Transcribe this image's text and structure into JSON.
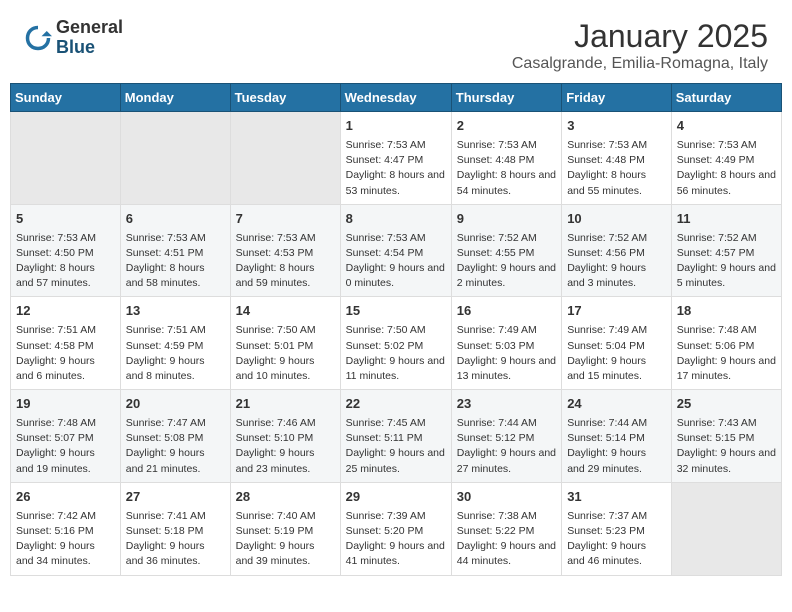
{
  "header": {
    "logo_general": "General",
    "logo_blue": "Blue",
    "month_title": "January 2025",
    "subtitle": "Casalgrande, Emilia-Romagna, Italy"
  },
  "weekdays": [
    "Sunday",
    "Monday",
    "Tuesday",
    "Wednesday",
    "Thursday",
    "Friday",
    "Saturday"
  ],
  "weeks": [
    [
      {
        "day": "",
        "info": ""
      },
      {
        "day": "",
        "info": ""
      },
      {
        "day": "",
        "info": ""
      },
      {
        "day": "1",
        "info": "Sunrise: 7:53 AM\nSunset: 4:47 PM\nDaylight: 8 hours and 53 minutes."
      },
      {
        "day": "2",
        "info": "Sunrise: 7:53 AM\nSunset: 4:48 PM\nDaylight: 8 hours and 54 minutes."
      },
      {
        "day": "3",
        "info": "Sunrise: 7:53 AM\nSunset: 4:48 PM\nDaylight: 8 hours and 55 minutes."
      },
      {
        "day": "4",
        "info": "Sunrise: 7:53 AM\nSunset: 4:49 PM\nDaylight: 8 hours and 56 minutes."
      }
    ],
    [
      {
        "day": "5",
        "info": "Sunrise: 7:53 AM\nSunset: 4:50 PM\nDaylight: 8 hours and 57 minutes."
      },
      {
        "day": "6",
        "info": "Sunrise: 7:53 AM\nSunset: 4:51 PM\nDaylight: 8 hours and 58 minutes."
      },
      {
        "day": "7",
        "info": "Sunrise: 7:53 AM\nSunset: 4:53 PM\nDaylight: 8 hours and 59 minutes."
      },
      {
        "day": "8",
        "info": "Sunrise: 7:53 AM\nSunset: 4:54 PM\nDaylight: 9 hours and 0 minutes."
      },
      {
        "day": "9",
        "info": "Sunrise: 7:52 AM\nSunset: 4:55 PM\nDaylight: 9 hours and 2 minutes."
      },
      {
        "day": "10",
        "info": "Sunrise: 7:52 AM\nSunset: 4:56 PM\nDaylight: 9 hours and 3 minutes."
      },
      {
        "day": "11",
        "info": "Sunrise: 7:52 AM\nSunset: 4:57 PM\nDaylight: 9 hours and 5 minutes."
      }
    ],
    [
      {
        "day": "12",
        "info": "Sunrise: 7:51 AM\nSunset: 4:58 PM\nDaylight: 9 hours and 6 minutes."
      },
      {
        "day": "13",
        "info": "Sunrise: 7:51 AM\nSunset: 4:59 PM\nDaylight: 9 hours and 8 minutes."
      },
      {
        "day": "14",
        "info": "Sunrise: 7:50 AM\nSunset: 5:01 PM\nDaylight: 9 hours and 10 minutes."
      },
      {
        "day": "15",
        "info": "Sunrise: 7:50 AM\nSunset: 5:02 PM\nDaylight: 9 hours and 11 minutes."
      },
      {
        "day": "16",
        "info": "Sunrise: 7:49 AM\nSunset: 5:03 PM\nDaylight: 9 hours and 13 minutes."
      },
      {
        "day": "17",
        "info": "Sunrise: 7:49 AM\nSunset: 5:04 PM\nDaylight: 9 hours and 15 minutes."
      },
      {
        "day": "18",
        "info": "Sunrise: 7:48 AM\nSunset: 5:06 PM\nDaylight: 9 hours and 17 minutes."
      }
    ],
    [
      {
        "day": "19",
        "info": "Sunrise: 7:48 AM\nSunset: 5:07 PM\nDaylight: 9 hours and 19 minutes."
      },
      {
        "day": "20",
        "info": "Sunrise: 7:47 AM\nSunset: 5:08 PM\nDaylight: 9 hours and 21 minutes."
      },
      {
        "day": "21",
        "info": "Sunrise: 7:46 AM\nSunset: 5:10 PM\nDaylight: 9 hours and 23 minutes."
      },
      {
        "day": "22",
        "info": "Sunrise: 7:45 AM\nSunset: 5:11 PM\nDaylight: 9 hours and 25 minutes."
      },
      {
        "day": "23",
        "info": "Sunrise: 7:44 AM\nSunset: 5:12 PM\nDaylight: 9 hours and 27 minutes."
      },
      {
        "day": "24",
        "info": "Sunrise: 7:44 AM\nSunset: 5:14 PM\nDaylight: 9 hours and 29 minutes."
      },
      {
        "day": "25",
        "info": "Sunrise: 7:43 AM\nSunset: 5:15 PM\nDaylight: 9 hours and 32 minutes."
      }
    ],
    [
      {
        "day": "26",
        "info": "Sunrise: 7:42 AM\nSunset: 5:16 PM\nDaylight: 9 hours and 34 minutes."
      },
      {
        "day": "27",
        "info": "Sunrise: 7:41 AM\nSunset: 5:18 PM\nDaylight: 9 hours and 36 minutes."
      },
      {
        "day": "28",
        "info": "Sunrise: 7:40 AM\nSunset: 5:19 PM\nDaylight: 9 hours and 39 minutes."
      },
      {
        "day": "29",
        "info": "Sunrise: 7:39 AM\nSunset: 5:20 PM\nDaylight: 9 hours and 41 minutes."
      },
      {
        "day": "30",
        "info": "Sunrise: 7:38 AM\nSunset: 5:22 PM\nDaylight: 9 hours and 44 minutes."
      },
      {
        "day": "31",
        "info": "Sunrise: 7:37 AM\nSunset: 5:23 PM\nDaylight: 9 hours and 46 minutes."
      },
      {
        "day": "",
        "info": ""
      }
    ]
  ]
}
